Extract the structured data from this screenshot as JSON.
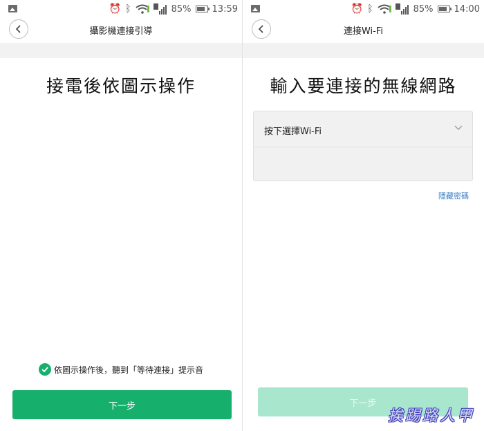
{
  "left": {
    "status": {
      "battery": "85%",
      "time": "13:59"
    },
    "nav_title": "攝影機連接引導",
    "headline": "接電後依圖示操作",
    "hint": "依圖示操作後，聽到「等待連接」提示音",
    "next_label": "下一步"
  },
  "right": {
    "status": {
      "battery": "85%",
      "time": "14:00"
    },
    "nav_title": "連接Wi-Fi",
    "headline": "輸入要連接的無線網路",
    "wifi_select_label": "按下選擇Wi-Fi",
    "password_value": "",
    "hide_password": "隱藏密碼",
    "next_label": "下一步"
  },
  "watermark": "挨踢路人甲",
  "colors": {
    "accent": "#16b06c",
    "accent_disabled": "#a8e6cd",
    "link": "#3a7ec6"
  },
  "icons": [
    "gallery-icon",
    "alarm-icon",
    "bluetooth-icon",
    "wifi-icon",
    "sim-signal-icon",
    "battery-icon",
    "back-chevron-icon",
    "check-circle-icon",
    "chevron-down-icon"
  ]
}
